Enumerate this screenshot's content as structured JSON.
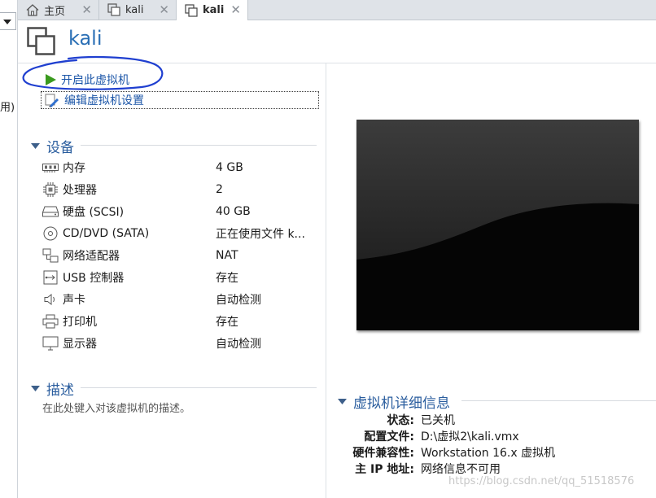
{
  "library": {
    "collapsed_text": "用)"
  },
  "tabs": [
    {
      "label": "主页",
      "icon": "home-icon",
      "active": false
    },
    {
      "label": "kali",
      "icon": "vm-icon",
      "active": false
    },
    {
      "label": "kali",
      "icon": "vm-icon",
      "active": true
    }
  ],
  "vm": {
    "title": "kali"
  },
  "actions": {
    "power_on": "开启此虚拟机",
    "edit_settings": "编辑虚拟机设置"
  },
  "devices": {
    "heading": "设备",
    "items": [
      {
        "name": "内存",
        "value": "4 GB",
        "icon": "memory-icon"
      },
      {
        "name": "处理器",
        "value": "2",
        "icon": "cpu-icon"
      },
      {
        "name": "硬盘 (SCSI)",
        "value": "40 GB",
        "icon": "hard-disk-icon"
      },
      {
        "name": "CD/DVD (SATA)",
        "value": "正在使用文件 k...",
        "icon": "cd-dvd-icon"
      },
      {
        "name": "网络适配器",
        "value": "NAT",
        "icon": "network-adapter-icon"
      },
      {
        "name": "USB 控制器",
        "value": "存在",
        "icon": "usb-icon"
      },
      {
        "name": "声卡",
        "value": "自动检测",
        "icon": "sound-icon"
      },
      {
        "name": "打印机",
        "value": "存在",
        "icon": "printer-icon"
      },
      {
        "name": "显示器",
        "value": "自动检测",
        "icon": "monitor-icon"
      }
    ]
  },
  "description": {
    "heading": "描述",
    "placeholder": "在此处键入对该虚拟机的描述。"
  },
  "details": {
    "heading": "虚拟机详细信息",
    "rows": [
      {
        "key": "状态:",
        "value": "已关机"
      },
      {
        "key": "配置文件:",
        "value": "D:\\虚拟2\\kali.vmx"
      },
      {
        "key": "硬件兼容性:",
        "value": "Workstation 16.x 虚拟机"
      },
      {
        "key": "主 IP 地址:",
        "value": "网络信息不可用"
      }
    ]
  },
  "watermark": "https://blog.csdn.net/qq_51518576",
  "colors": {
    "accent": "#2a6fb5",
    "power_green": "#3a9a1e",
    "annotation": "#1f3fd0"
  }
}
